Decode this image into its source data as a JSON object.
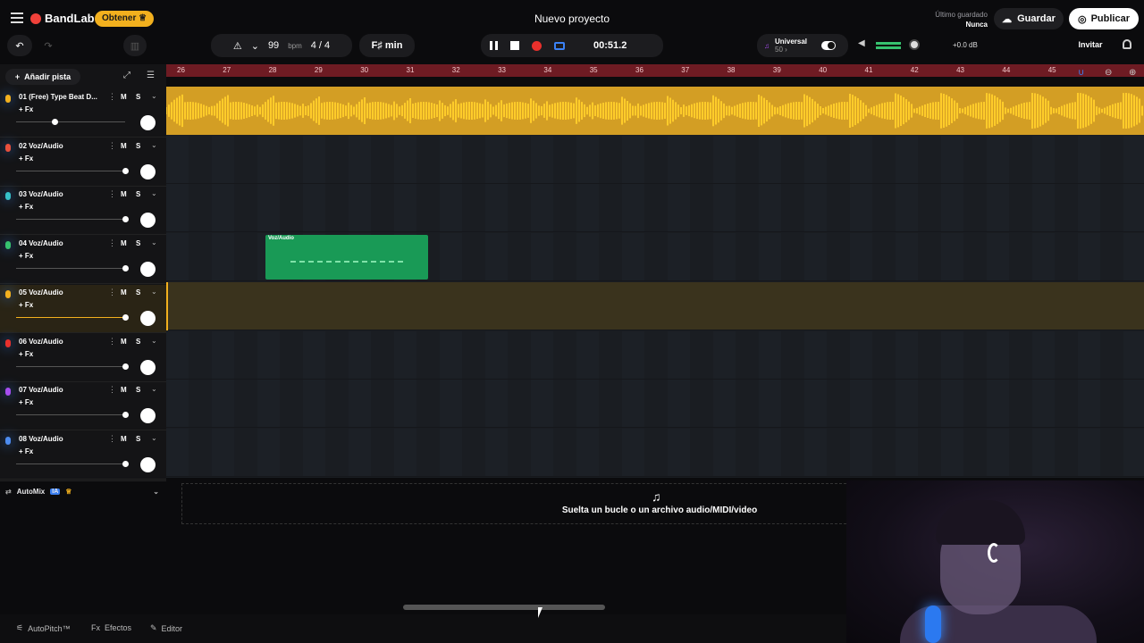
{
  "header": {
    "brand": "BandLab",
    "obtener_label": "Obtener",
    "project_title": "Nuevo proyecto",
    "last_saved_label": "Último guardado",
    "last_saved_value": "Nunca",
    "save_label": "Guardar",
    "publish_label": "Publicar"
  },
  "toolbar": {
    "bpm_value": "99",
    "bpm_unit": "bpm",
    "time_signature": "4 / 4",
    "key": "F♯ min",
    "time": "00:51.2",
    "tuner_name": "Universal",
    "tuner_value": "50 ›",
    "db_value": "+0.0 dB",
    "invite_label": "Invitar"
  },
  "tracks_panel": {
    "add_track_label": "Añadir pista",
    "fx_label": "+ Fx",
    "mute_label": "M",
    "solo_label": "S",
    "tracks": [
      {
        "name": "01 (Free) Type Beat D...",
        "color": "#f2b01e",
        "fader": 0.35
      },
      {
        "name": "02 Voz/Audio",
        "color": "#e8503c",
        "fader": 1.0
      },
      {
        "name": "03 Voz/Audio",
        "color": "#36c0c8",
        "fader": 1.0
      },
      {
        "name": "04 Voz/Audio",
        "color": "#36c26f",
        "fader": 1.0
      },
      {
        "name": "05 Voz/Audio",
        "color": "#f2b01e",
        "fader": 1.0
      },
      {
        "name": "06 Voz/Audio",
        "color": "#e8302c",
        "fader": 1.0
      },
      {
        "name": "07 Voz/Audio",
        "color": "#a64df0",
        "fader": 1.0
      },
      {
        "name": "08 Voz/Audio",
        "color": "#4d8cf0",
        "fader": 1.0
      }
    ],
    "automix_label": "AutoMix",
    "automix_badge": "IA"
  },
  "ruler": {
    "bars": [
      "26",
      "27",
      "28",
      "29",
      "30",
      "31",
      "32",
      "33",
      "34",
      "35",
      "36",
      "37",
      "38",
      "39",
      "40",
      "41",
      "42",
      "43",
      "44",
      "45"
    ]
  },
  "clip": {
    "label": "Voz/Audio"
  },
  "dropzone": {
    "text": "Suelta un bucle o un archivo audio/MIDI/video"
  },
  "bottom": {
    "autopitch": "AutoPitch™",
    "effects": "Efectos",
    "editor": "Editor"
  },
  "colors": {
    "accent": "#f2b01e",
    "record": "#e8302c",
    "ruler": "#6e1b23",
    "clip": "#199a56"
  }
}
